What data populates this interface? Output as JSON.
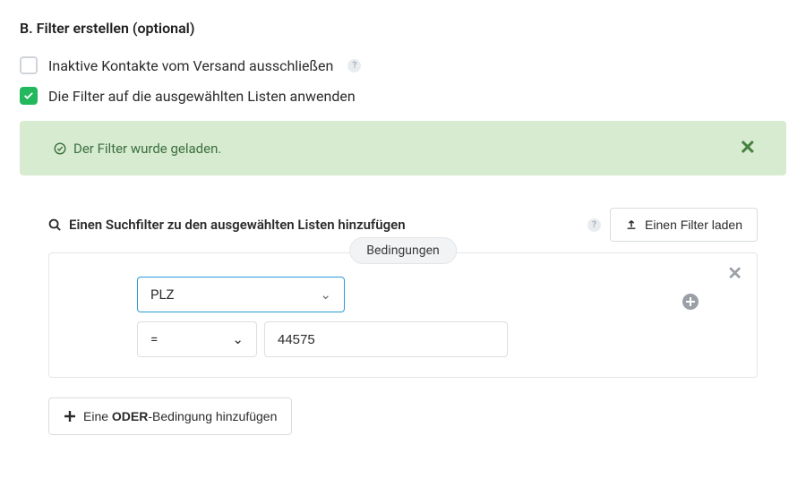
{
  "title": "B. Filter erstellen (optional)",
  "checkboxes": {
    "exclude_inactive": {
      "label": "Inaktive Kontakte vom Versand ausschließen",
      "checked": false
    },
    "apply_filter": {
      "label": "Die Filter auf die ausgewählten Listen anwenden",
      "checked": true
    }
  },
  "alert": {
    "text": "Der Filter wurde geladen."
  },
  "search_label": "Einen Suchfilter zu den ausgewählten Listen hinzufügen",
  "load_filter_btn": "Einen Filter laden",
  "conditions_badge": "Bedingungen",
  "condition": {
    "field": "PLZ",
    "operator": "=",
    "value": "44575"
  },
  "add_or": {
    "prefix": "Eine ",
    "bold": "ODER",
    "suffix": "-Bedingung hinzufügen"
  }
}
